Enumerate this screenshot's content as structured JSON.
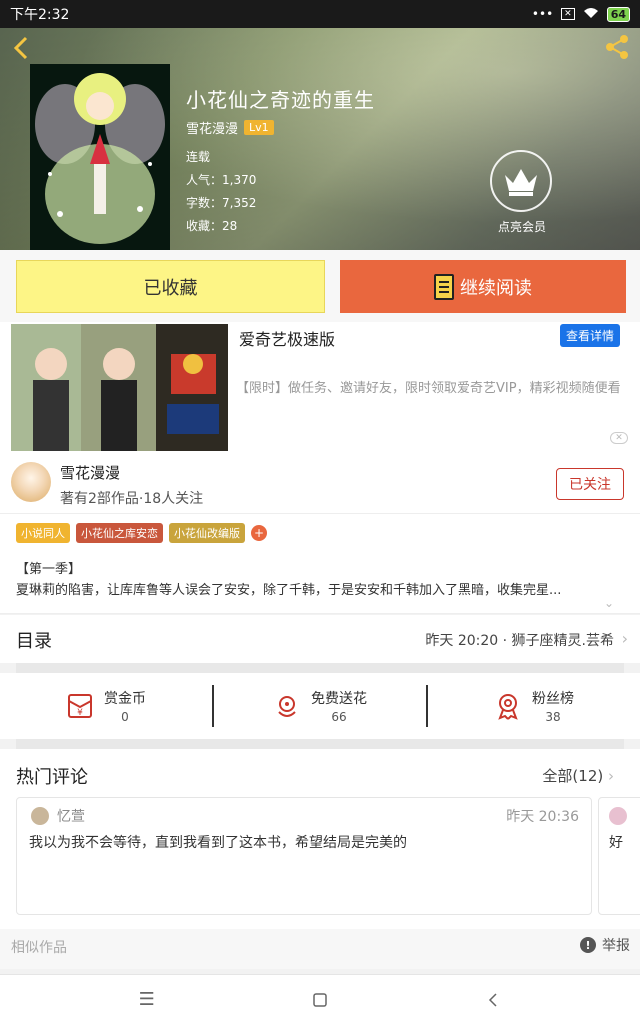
{
  "status_bar": {
    "time": "下午2:32",
    "battery": "64"
  },
  "book": {
    "title": "小花仙之奇迹的重生",
    "author": "雪花漫漫",
    "author_level": "Lv1",
    "status": "连载",
    "popularity": "人气：1,370",
    "word_count": "字数：7,352",
    "favorites": "收藏：28",
    "vip_label": "点亮会员"
  },
  "actions": {
    "favorited_label": "已收藏",
    "continue_label": "继续阅读"
  },
  "ad": {
    "title": "爱奇艺极速版",
    "detail_button": "查看详情",
    "description": "【限时】做任务、邀请好友，限时领取爱奇艺VIP，精彩视频随便看"
  },
  "author_info": {
    "name": "雪花漫漫",
    "stats": "著有2部作品·18人关注",
    "follow_label": "已关注"
  },
  "tags": [
    {
      "label": "小说同人",
      "color": "#f0b430"
    },
    {
      "label": "小花仙之库安恋",
      "color": "#c9573c"
    },
    {
      "label": "小花仙改编版",
      "color": "#c9a43c"
    }
  ],
  "intro": {
    "season": "【第一季】",
    "text": "夏琳莉的陷害，让库库鲁等人误会了安安，除了千韩，于是安安和千韩加入了黑暗，收集完星..."
  },
  "catalog": {
    "title": "目录",
    "latest": "昨天 20:20 · 狮子座精灵.芸希"
  },
  "rewards": [
    {
      "label": "赏金币",
      "count": "0",
      "icon": "red-envelope-icon"
    },
    {
      "label": "免费送花",
      "count": "66",
      "icon": "flower-icon"
    },
    {
      "label": "粉丝榜",
      "count": "38",
      "icon": "medal-icon"
    }
  ],
  "comments": {
    "title": "热门评论",
    "all_label": "全部(12)",
    "items": [
      {
        "user": "忆萱",
        "time": "昨天 20:36",
        "text": "我以为我不会等待，直到我看到了这本书，希望结局是完美的"
      },
      {
        "text": "好"
      }
    ]
  },
  "footer": {
    "similar_label": "相似作品",
    "report_label": "举报"
  }
}
